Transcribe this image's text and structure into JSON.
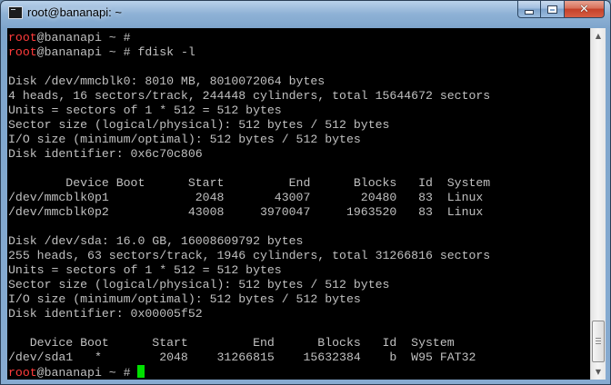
{
  "window": {
    "title": "root@bananapi: ~",
    "controls": {
      "minimize_icon": "minimize-icon",
      "maximize_icon": "maximize-icon",
      "close_icon": "close-icon",
      "close_glyph": "✕"
    }
  },
  "colors": {
    "terminal_background": "#000000",
    "terminal_text": "#c0c0c0",
    "prompt_user": "#ff3b3b",
    "cursor": "#00e000"
  },
  "terminal": {
    "prompt_user": "root",
    "prompt_rest": "@bananapi ~ #",
    "lines": [
      {
        "type": "prompt",
        "command": ""
      },
      {
        "type": "prompt",
        "command": "fdisk -l"
      },
      {
        "type": "text",
        "text": ""
      },
      {
        "type": "text",
        "text": "Disk /dev/mmcblk0: 8010 MB, 8010072064 bytes"
      },
      {
        "type": "text",
        "text": "4 heads, 16 sectors/track, 244448 cylinders, total 15644672 sectors"
      },
      {
        "type": "text",
        "text": "Units = sectors of 1 * 512 = 512 bytes"
      },
      {
        "type": "text",
        "text": "Sector size (logical/physical): 512 bytes / 512 bytes"
      },
      {
        "type": "text",
        "text": "I/O size (minimum/optimal): 512 bytes / 512 bytes"
      },
      {
        "type": "text",
        "text": "Disk identifier: 0x6c70c806"
      },
      {
        "type": "text",
        "text": ""
      },
      {
        "type": "text",
        "text": "        Device Boot      Start         End      Blocks   Id  System"
      },
      {
        "type": "text",
        "text": "/dev/mmcblk0p1            2048       43007       20480   83  Linux"
      },
      {
        "type": "text",
        "text": "/dev/mmcblk0p2           43008     3970047     1963520   83  Linux"
      },
      {
        "type": "text",
        "text": ""
      },
      {
        "type": "text",
        "text": "Disk /dev/sda: 16.0 GB, 16008609792 bytes"
      },
      {
        "type": "text",
        "text": "255 heads, 63 sectors/track, 1946 cylinders, total 31266816 sectors"
      },
      {
        "type": "text",
        "text": "Units = sectors of 1 * 512 = 512 bytes"
      },
      {
        "type": "text",
        "text": "Sector size (logical/physical): 512 bytes / 512 bytes"
      },
      {
        "type": "text",
        "text": "I/O size (minimum/optimal): 512 bytes / 512 bytes"
      },
      {
        "type": "text",
        "text": "Disk identifier: 0x00005f52"
      },
      {
        "type": "text",
        "text": ""
      },
      {
        "type": "text",
        "text": "   Device Boot      Start         End      Blocks   Id  System"
      },
      {
        "type": "text",
        "text": "/dev/sda1   *        2048    31266815    15632384    b  W95 FAT32"
      },
      {
        "type": "prompt",
        "command": "",
        "cursor": true
      }
    ]
  },
  "scrollbar": {
    "up_icon": "scroll-up-arrow-icon",
    "down_icon": "scroll-down-arrow-icon",
    "up_glyph": "▲",
    "down_glyph": "▼"
  }
}
